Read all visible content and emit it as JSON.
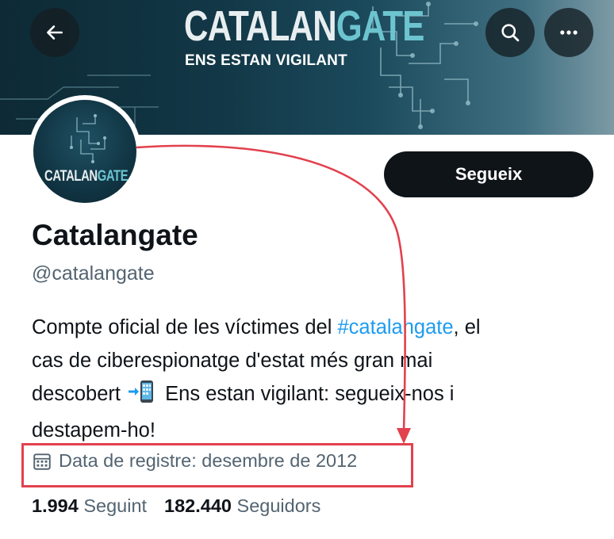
{
  "banner": {
    "title_part1": "CATALAN",
    "title_part2": "GATE",
    "subtitle": "ENS ESTAN VIGILANT"
  },
  "header_icons": {
    "back": "arrow-left-icon",
    "search": "search-icon",
    "more": "more-horizontal-icon"
  },
  "avatar": {
    "text_part1": "CATALAN",
    "text_part2": "GATE"
  },
  "profile": {
    "follow_label": "Segueix",
    "name": "Catalangate",
    "handle": "@catalangate",
    "bio_line1_pre": "Compte oficial de les víctimes del ",
    "bio_hashtag": "#catalangate",
    "bio_line1_post": ", el",
    "bio_line2": "cas de ciberespionatge d'estat més gran mai",
    "bio_line3_pre": "descobert ",
    "bio_line3_post": " Ens estan vigilant: segueix-nos i",
    "bio_line4": "destapem-ho!",
    "joined": "Data de registre: desembre de 2012",
    "following_count": "1.994",
    "following_label": "Seguint",
    "followers_count": "182.440",
    "followers_label": "Seguidors"
  },
  "colors": {
    "accent": "#1d9bf0",
    "annotation": "#e2414e",
    "banner_dark": "#123746",
    "banner_teal": "#6cc4cf"
  }
}
